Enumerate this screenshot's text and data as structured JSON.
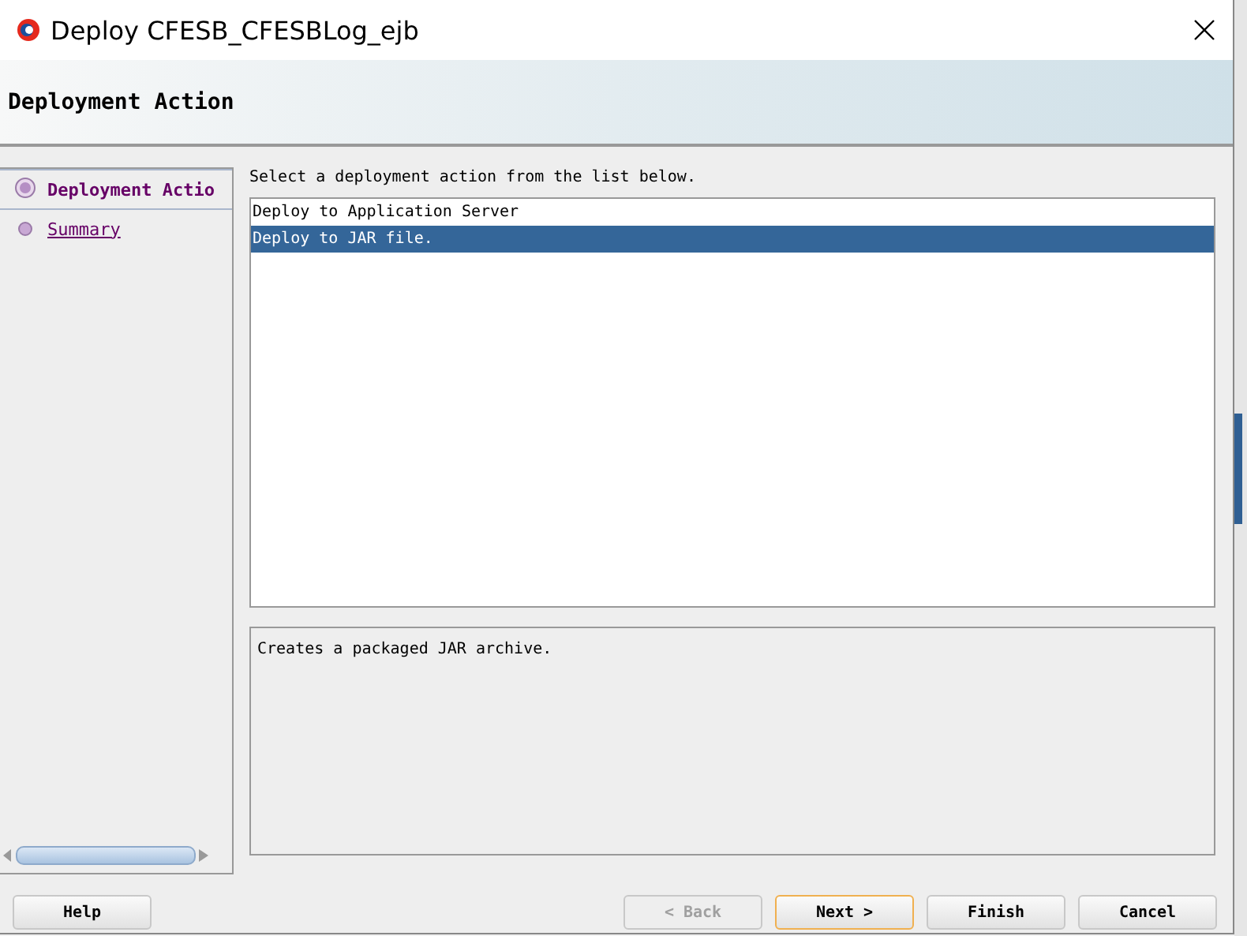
{
  "window": {
    "title": "Deploy CFESB_CFESBLog_ejb"
  },
  "header": {
    "title": "Deployment Action"
  },
  "steps": [
    {
      "label": "Deployment Actio",
      "selected": true
    },
    {
      "label": "Summary",
      "selected": false
    }
  ],
  "prompt": "Select a deployment action from the list below.",
  "actions": [
    {
      "label": "Deploy to Application Server",
      "selected": false
    },
    {
      "label": "Deploy to JAR file.",
      "selected": true
    }
  ],
  "description": "Creates a packaged JAR archive.",
  "buttons": [
    {
      "label": "Help",
      "disabled": false,
      "default": false
    },
    {
      "label": "< Back",
      "disabled": true,
      "default": false
    },
    {
      "label": "Next >",
      "disabled": false,
      "default": true
    },
    {
      "label": "Finish",
      "disabled": false,
      "default": false
    },
    {
      "label": "Cancel",
      "disabled": false,
      "default": false
    }
  ]
}
